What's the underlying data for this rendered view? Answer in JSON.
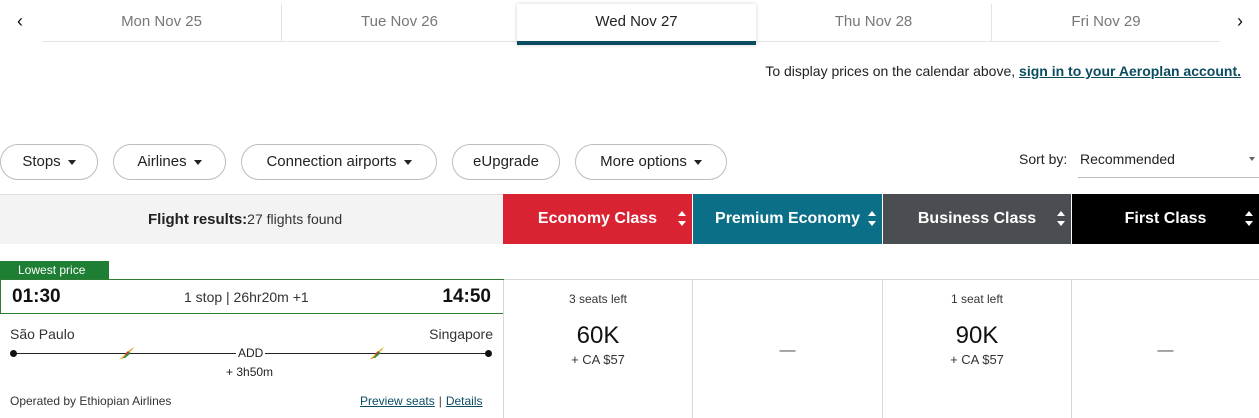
{
  "date_nav": {
    "prev_arrow": "‹",
    "next_arrow": "›",
    "tabs": [
      {
        "label": "Mon Nov 25"
      },
      {
        "label": "Tue Nov 26"
      },
      {
        "label": "Wed Nov 27"
      },
      {
        "label": "Thu Nov 28"
      },
      {
        "label": "Fri Nov 29"
      }
    ]
  },
  "signin": {
    "text": "To display prices on the calendar above, ",
    "link": "sign in to your Aeroplan account."
  },
  "filters": {
    "stops": "Stops",
    "airlines": "Airlines",
    "connection_airports": "Connection airports",
    "eupgrade": "eUpgrade",
    "more_options": "More options"
  },
  "sort": {
    "label": "Sort by:",
    "value": "Recommended"
  },
  "results": {
    "label": "Flight results:",
    "count": "27 flights found"
  },
  "cabins": [
    {
      "label": "Economy Class",
      "color": "#d92332"
    },
    {
      "label": "Premium Economy",
      "color": "#0a6f87"
    },
    {
      "label": "Business Class",
      "color": "#4a4e52"
    },
    {
      "label": "First Class",
      "color": "#000000"
    }
  ],
  "flight": {
    "badge": "Lowest price",
    "departure": "01:30",
    "arrival": "14:50",
    "duration": "1 stop | 26hr20m +1",
    "origin": "São Paulo",
    "destination": "Singapore",
    "stop_code": "ADD",
    "layover": "+ 3h50m",
    "operator": "Operated by Ethiopian Airlines",
    "preview_seats": "Preview seats",
    "details": "Details",
    "separator": "|",
    "fares": {
      "economy": {
        "seats": "3 seats left",
        "points": "60K",
        "tax": "+ CA $57"
      },
      "premium": {
        "dash": "—"
      },
      "business": {
        "seats": "1 seat left",
        "points": "90K",
        "tax": "+ CA $57"
      },
      "first": {
        "dash": "—"
      }
    }
  }
}
